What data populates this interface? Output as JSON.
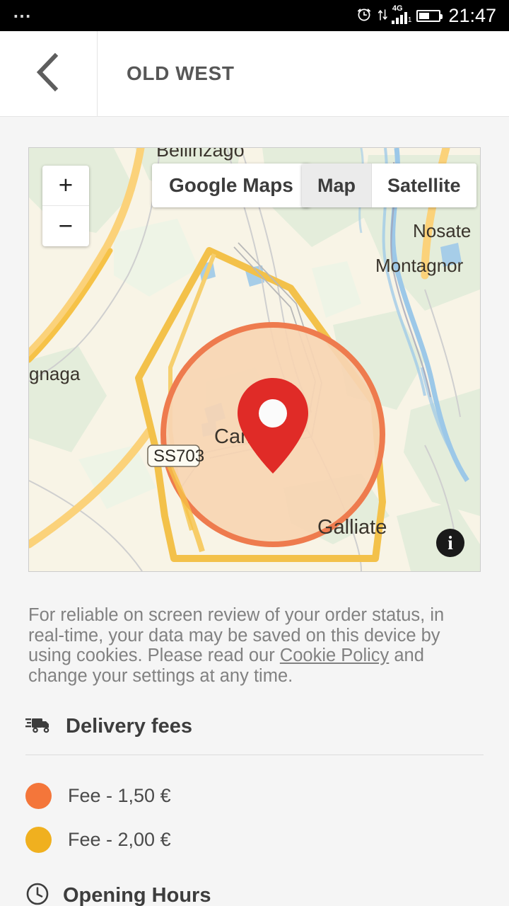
{
  "status_bar": {
    "notifications_icon": "more-dots-icon",
    "alarm_icon": "alarm-clock-icon",
    "sync_icon": "data-transfer-icon",
    "network_label": "4G",
    "sim_label": "1",
    "battery_icon": "battery-half-icon",
    "time": "21:47"
  },
  "header": {
    "back_icon": "chevron-left-icon",
    "title": "OLD WEST"
  },
  "map": {
    "zoom_in_label": "+",
    "zoom_out_label": "−",
    "google_maps_label": "Google Maps",
    "type_map_label": "Map",
    "type_satellite_label": "Satellite",
    "type_selected": "Map",
    "info_label": "i",
    "marker_icon": "map-pin-icon",
    "labels": [
      "Bellinzago",
      "Nosate",
      "Montagnor",
      "gnaga",
      "Cam",
      "Galliate"
    ],
    "road_shield": "SS703",
    "delivery_zone_circle_color": "#ee7b4e",
    "delivery_zone_fill_color": "#f6d3b0",
    "delivery_zone_outer_color": "#f0b429"
  },
  "cookie_notice": {
    "text_before": "For reliable on screen review of your order status, in real-time, your data may be saved on this device by using cookies. Please read our ",
    "link_label": "Cookie Policy",
    "text_after": " and change your settings at any time."
  },
  "delivery_fees": {
    "icon": "delivery-truck-icon",
    "title": "Delivery fees",
    "items": [
      {
        "color": "#f4763a",
        "label": "Fee - 1,50 €"
      },
      {
        "color": "#f0b01f",
        "label": "Fee - 2,00 €"
      }
    ]
  },
  "opening_hours": {
    "icon": "clock-icon",
    "title": "Opening Hours"
  }
}
